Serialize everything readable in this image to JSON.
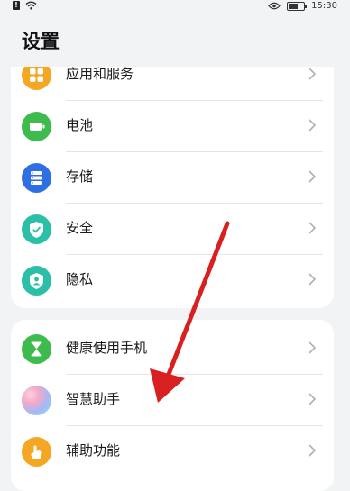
{
  "status_bar": {
    "time": "15:30"
  },
  "page_title": "设置",
  "group1": [
    {
      "label": "应用和服务",
      "icon": "apps-icon",
      "color": "#f5a623"
    },
    {
      "label": "电池",
      "icon": "battery-icon",
      "color": "#3dbb4c"
    },
    {
      "label": "存储",
      "icon": "storage-icon",
      "color": "#2f6fe4"
    },
    {
      "label": "安全",
      "icon": "shield-check-icon",
      "color": "#2bbfa8"
    },
    {
      "label": "隐私",
      "icon": "privacy-shield-icon",
      "color": "#2bbfa8"
    }
  ],
  "group2": [
    {
      "label": "健康使用手机",
      "icon": "hourglass-icon",
      "color": "#3dbb4c"
    },
    {
      "label": "智慧助手",
      "icon": "assistant-orb-icon",
      "color": "#b39ddb"
    },
    {
      "label": "辅助功能",
      "icon": "hand-icon",
      "color": "#f5a623"
    }
  ],
  "annotation": {
    "color": "#d92020"
  }
}
